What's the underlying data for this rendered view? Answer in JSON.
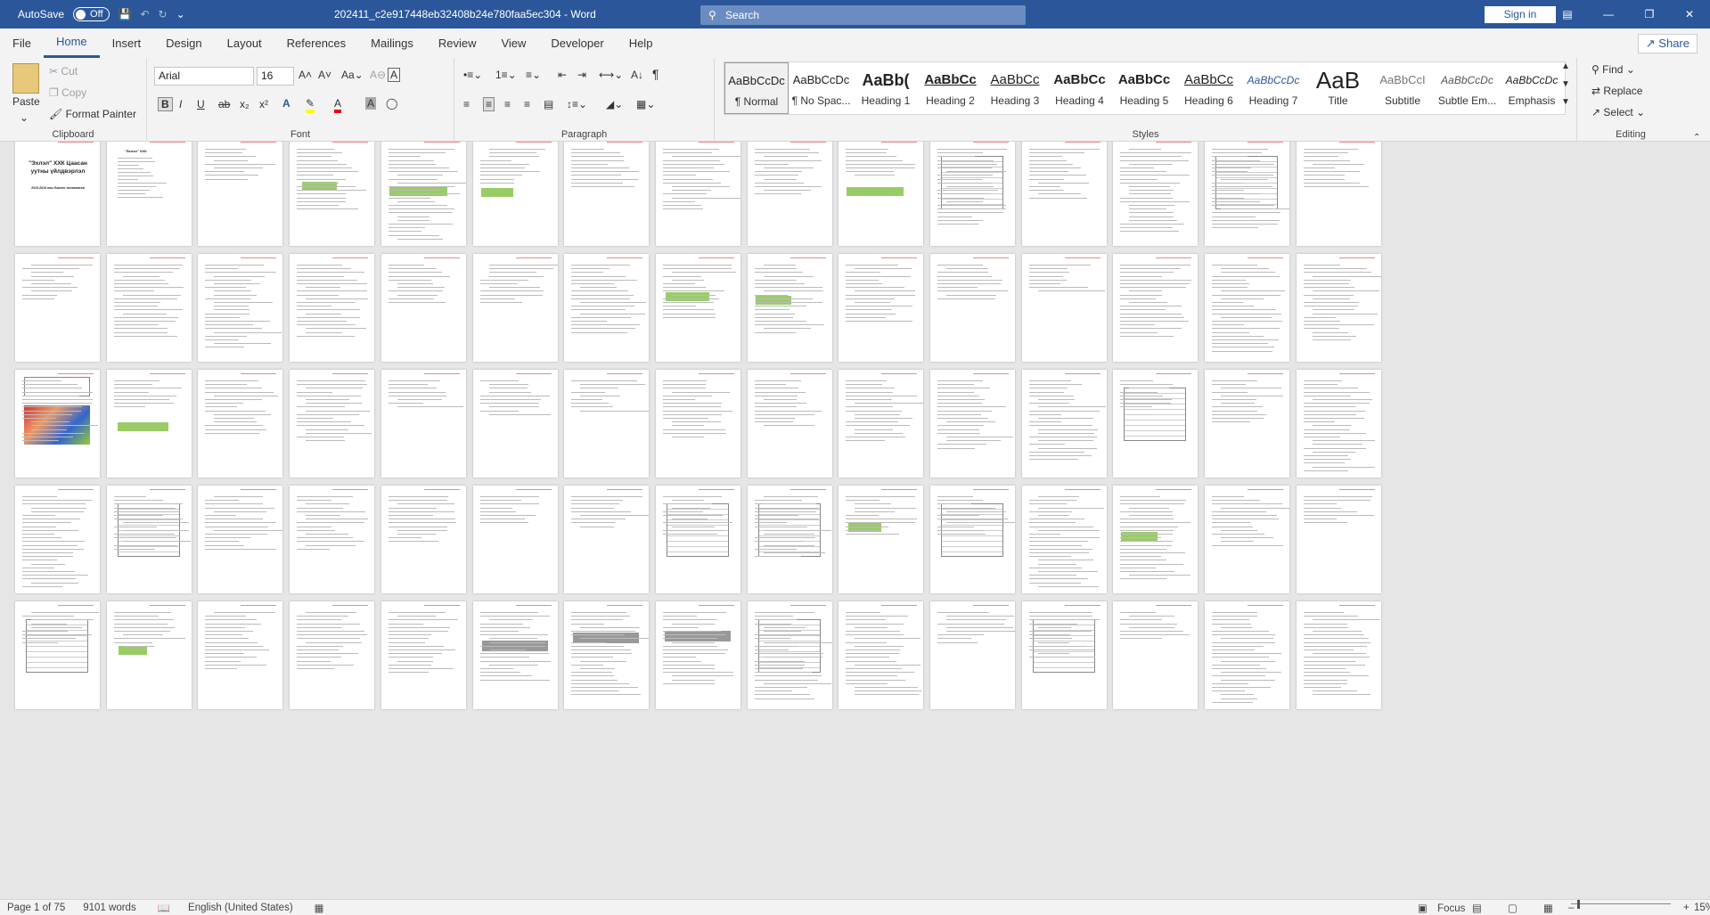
{
  "titlebar": {
    "autosave_label": "AutoSave",
    "autosave_state": "Off",
    "doc_title": "202411_c2e917448eb32408b24e780faa5ec304",
    "app_name": "Word",
    "title_sep": " - ",
    "search_placeholder": "Search",
    "signin": "Sign in"
  },
  "menu": {
    "tabs": [
      "File",
      "Home",
      "Insert",
      "Design",
      "Layout",
      "References",
      "Mailings",
      "Review",
      "View",
      "Developer",
      "Help"
    ],
    "active": "Home",
    "share": "Share"
  },
  "clipboard": {
    "paste": "Paste",
    "cut": "Cut",
    "copy": "Copy",
    "format_painter": "Format Painter",
    "label": "Clipboard"
  },
  "font": {
    "family": "Arial",
    "size": "16",
    "label": "Font"
  },
  "paragraph": {
    "label": "Paragraph"
  },
  "styles": {
    "label": "Styles",
    "items": [
      {
        "preview": "AaBbCcDc",
        "name": "¶ Normal"
      },
      {
        "preview": "AaBbCcDc",
        "name": "¶ No Spac..."
      },
      {
        "preview": "AaBb(",
        "name": "Heading 1"
      },
      {
        "preview": "AaBbCc",
        "name": "Heading 2"
      },
      {
        "preview": "AaBbCc",
        "name": "Heading 3"
      },
      {
        "preview": "AaBbCc",
        "name": "Heading 4"
      },
      {
        "preview": "AaBbCc",
        "name": "Heading 5"
      },
      {
        "preview": "AaBbCc",
        "name": "Heading 6"
      },
      {
        "preview": "AaBbCcDc",
        "name": "Heading 7"
      },
      {
        "preview": "AaB",
        "name": "Title"
      },
      {
        "preview": "AaBbCcI",
        "name": "Subtitle"
      },
      {
        "preview": "AaBbCcDc",
        "name": "Subtle Em..."
      },
      {
        "preview": "AaBbCcDc",
        "name": "Emphasis"
      }
    ]
  },
  "editing": {
    "find": "Find",
    "replace": "Replace",
    "select": "Select",
    "label": "Editing"
  },
  "pages": {
    "p1_line1": "\"Эхлэл\" ХХК Цаасан",
    "p1_line2": "уутны үйлдвэрлэл",
    "p1_line3": "2015-2016 оны Бизнес төлөвлөгөө",
    "p2_line1": "\"Эхлэл\" ХХК"
  },
  "status": {
    "page": "Page 1 of 75",
    "words": "9101 words",
    "language": "English (United States)",
    "focus": "Focus",
    "zoom": "15%"
  }
}
